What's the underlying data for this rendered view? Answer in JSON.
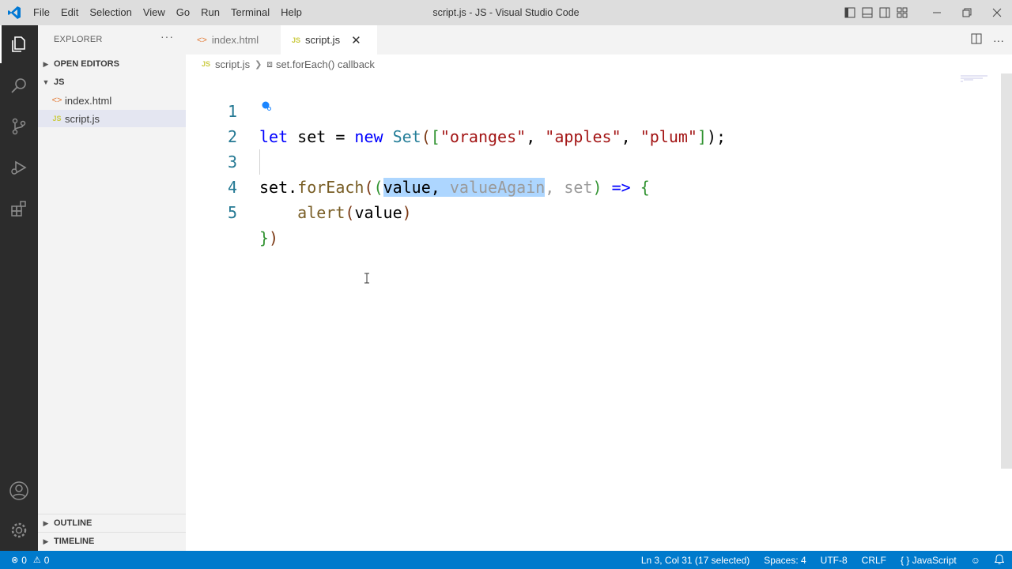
{
  "window": {
    "title": "script.js - JS - Visual Studio Code",
    "accent": "#007acc"
  },
  "menu": [
    "File",
    "Edit",
    "Selection",
    "View",
    "Go",
    "Run",
    "Terminal",
    "Help"
  ],
  "activity_bar": {
    "icons": [
      "explorer-icon",
      "search-icon",
      "source-control-icon",
      "run-debug-icon",
      "extensions-icon",
      "accounts-icon",
      "manage-gear-icon"
    ]
  },
  "sidebar": {
    "title": "EXPLORER",
    "more": "···",
    "open_editors": "OPEN EDITORS",
    "folder": "JS",
    "files": [
      {
        "name": "index.html",
        "type": "html"
      },
      {
        "name": "script.js",
        "type": "js"
      }
    ],
    "outline": "OUTLINE",
    "timeline": "TIMELINE"
  },
  "tabs": [
    {
      "label": "index.html",
      "active": false
    },
    {
      "label": "script.js",
      "active": true
    }
  ],
  "breadcrumbs": {
    "file": "script.js",
    "symbol": "set.forEach() callback"
  },
  "editor": {
    "line_numbers": [
      "1",
      "2",
      "3",
      "4",
      "5"
    ],
    "lines": {
      "l1": {
        "kw1": "let",
        "t1": " set = ",
        "kw2": "new",
        "sp": " ",
        "cls": "Set",
        "t2": "(",
        "b1": "[",
        "s1": "\"oranges\"",
        "c1": ", ",
        "s2": "\"apples\"",
        "c2": ", ",
        "s3": "\"plum\"",
        "b2": "]",
        "t3": ");"
      },
      "l3": {
        "t1": "set.",
        "fn": "forEach",
        "p1": "(",
        "p2": "(",
        "sel1": "value, ",
        "sel2": "valueAgain",
        "dim": ", set",
        "p3": ")",
        "arrow": " => ",
        "brace": "{"
      },
      "l4": {
        "indent": "    ",
        "fn": "alert",
        "p1": "(",
        "arg": "value",
        "p2": ")"
      },
      "l5": {
        "brace": "}",
        "p": ")"
      }
    }
  },
  "statusbar": {
    "errors": "0",
    "warnings": "0",
    "position": "Ln 3, Col 31 (17 selected)",
    "spaces": "Spaces: 4",
    "encoding": "UTF-8",
    "eol": "CRLF",
    "language": "{ } JavaScript"
  }
}
